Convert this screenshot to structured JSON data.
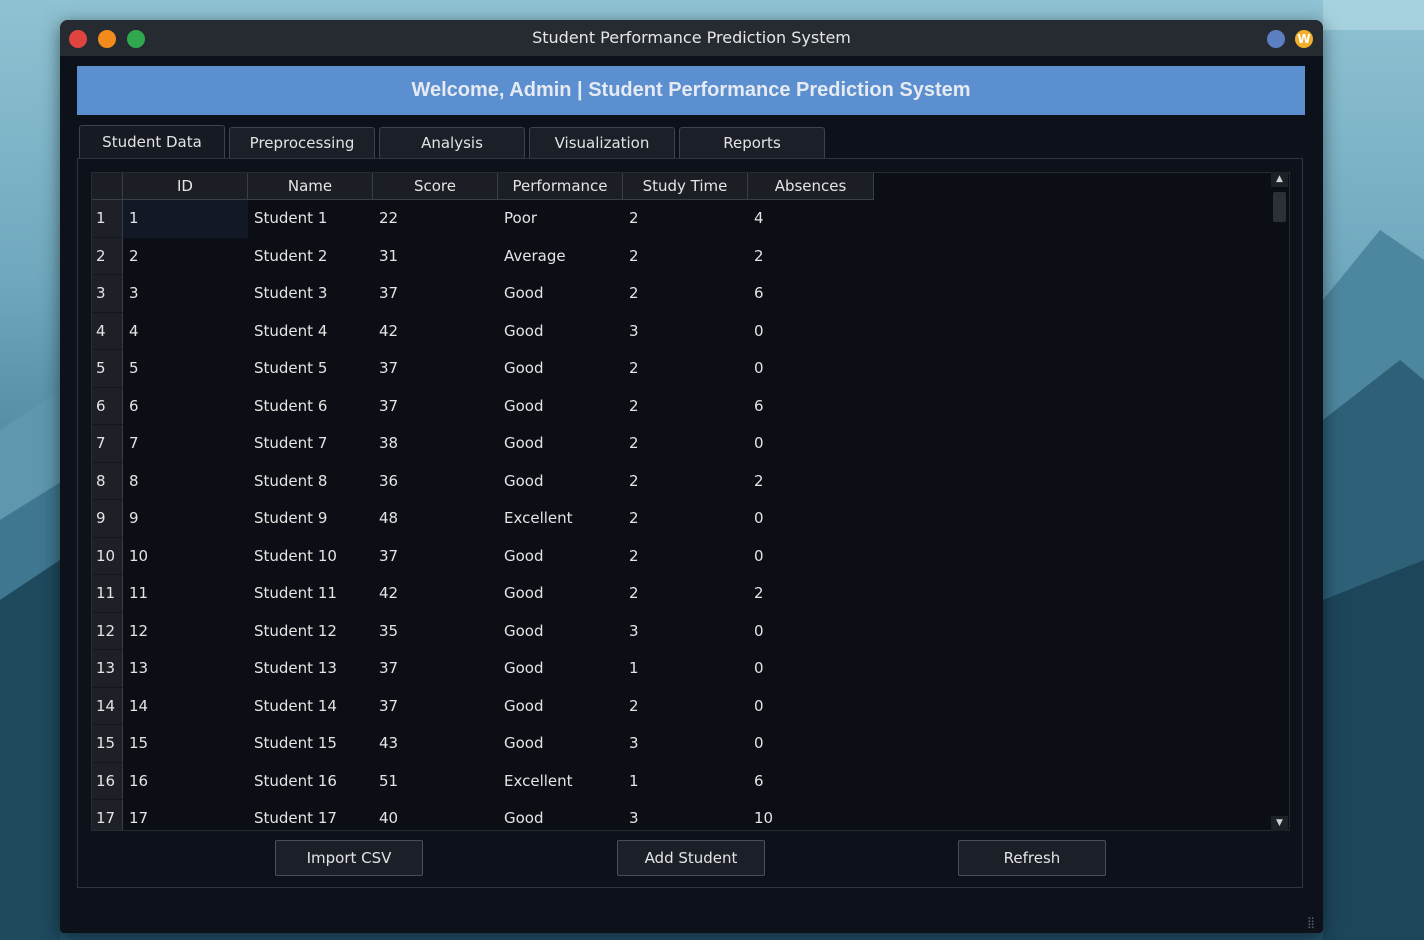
{
  "window": {
    "title": "Student Performance Prediction System",
    "banner": "Welcome, Admin | Student Performance Prediction System",
    "corner_icon": "W"
  },
  "tabs": [
    {
      "label": "Student Data",
      "active": true
    },
    {
      "label": "Preprocessing",
      "active": false
    },
    {
      "label": "Analysis",
      "active": false
    },
    {
      "label": "Visualization",
      "active": false
    },
    {
      "label": "Reports",
      "active": false
    }
  ],
  "table": {
    "columns": [
      "ID",
      "Name",
      "Score",
      "Performance",
      "Study Time",
      "Absences"
    ],
    "rows": [
      {
        "num": "1",
        "cells": [
          "1",
          "Student 1",
          "22",
          "Poor",
          "2",
          "4"
        ]
      },
      {
        "num": "2",
        "cells": [
          "2",
          "Student 2",
          "31",
          "Average",
          "2",
          "2"
        ]
      },
      {
        "num": "3",
        "cells": [
          "3",
          "Student 3",
          "37",
          "Good",
          "2",
          "6"
        ]
      },
      {
        "num": "4",
        "cells": [
          "4",
          "Student 4",
          "42",
          "Good",
          "3",
          "0"
        ]
      },
      {
        "num": "5",
        "cells": [
          "5",
          "Student 5",
          "37",
          "Good",
          "2",
          "0"
        ]
      },
      {
        "num": "6",
        "cells": [
          "6",
          "Student 6",
          "37",
          "Good",
          "2",
          "6"
        ]
      },
      {
        "num": "7",
        "cells": [
          "7",
          "Student 7",
          "38",
          "Good",
          "2",
          "0"
        ]
      },
      {
        "num": "8",
        "cells": [
          "8",
          "Student 8",
          "36",
          "Good",
          "2",
          "2"
        ]
      },
      {
        "num": "9",
        "cells": [
          "9",
          "Student 9",
          "48",
          "Excellent",
          "2",
          "0"
        ]
      },
      {
        "num": "10",
        "cells": [
          "10",
          "Student 10",
          "37",
          "Good",
          "2",
          "0"
        ]
      },
      {
        "num": "11",
        "cells": [
          "11",
          "Student 11",
          "42",
          "Good",
          "2",
          "2"
        ]
      },
      {
        "num": "12",
        "cells": [
          "12",
          "Student 12",
          "35",
          "Good",
          "3",
          "0"
        ]
      },
      {
        "num": "13",
        "cells": [
          "13",
          "Student 13",
          "37",
          "Good",
          "1",
          "0"
        ]
      },
      {
        "num": "14",
        "cells": [
          "14",
          "Student 14",
          "37",
          "Good",
          "2",
          "0"
        ]
      },
      {
        "num": "15",
        "cells": [
          "15",
          "Student 15",
          "43",
          "Good",
          "3",
          "0"
        ]
      },
      {
        "num": "16",
        "cells": [
          "16",
          "Student 16",
          "51",
          "Excellent",
          "1",
          "6"
        ]
      },
      {
        "num": "17",
        "cells": [
          "17",
          "Student 17",
          "40",
          "Good",
          "3",
          "10"
        ]
      }
    ]
  },
  "buttons": {
    "import_csv": "Import CSV",
    "add_student": "Add Student",
    "refresh": "Refresh"
  },
  "colors": {
    "banner": "#5b8fcf",
    "window_bg": "#0d111a"
  }
}
